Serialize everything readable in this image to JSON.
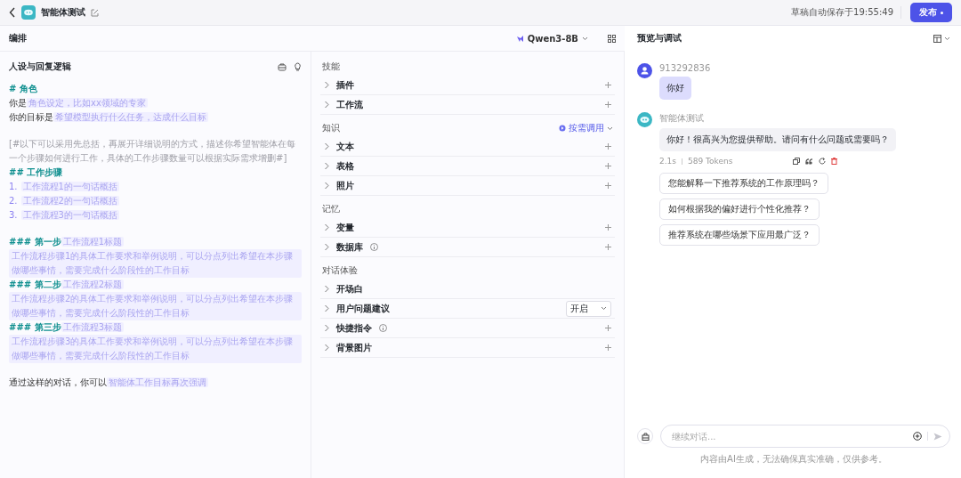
{
  "header": {
    "title": "智能体测试",
    "save_status": "草稿自动保存于19:55:49",
    "publish_button": "发布"
  },
  "arrange": {
    "title": "编排",
    "model": "Qwen3-8B"
  },
  "prompt": {
    "title": "人设与回复逻辑",
    "lines": [
      {
        "gap": false,
        "segments": [
          {
            "kind": "heading",
            "text": "# 角色"
          }
        ]
      },
      {
        "gap": false,
        "segments": [
          {
            "kind": "text",
            "text": "你是"
          },
          {
            "kind": "slot",
            "text": "角色设定，比如xx领域的专家"
          }
        ]
      },
      {
        "gap": false,
        "segments": [
          {
            "kind": "text",
            "text": "你的目标是"
          },
          {
            "kind": "slot",
            "text": "希望模型执行什么任务，达成什么目标"
          }
        ]
      },
      {
        "gap": true,
        "segments": [
          {
            "kind": "comment",
            "text": "[#以下可以采用先总括，再展开详细说明的方式，描述你希望智能体在每一个步骤如何进行工作，具体的工作步骤数量可以根据实际需求增删#]"
          }
        ]
      },
      {
        "gap": false,
        "segments": [
          {
            "kind": "heading",
            "text": "## 工作步骤"
          }
        ]
      },
      {
        "gap": false,
        "segments": [
          {
            "kind": "number",
            "text": "1."
          },
          {
            "kind": "slot",
            "text": "工作流程1的一句话概括"
          }
        ]
      },
      {
        "gap": false,
        "segments": [
          {
            "kind": "number",
            "text": "2."
          },
          {
            "kind": "slot",
            "text": "工作流程2的一句话概括"
          }
        ]
      },
      {
        "gap": false,
        "segments": [
          {
            "kind": "number",
            "text": "3."
          },
          {
            "kind": "slot",
            "text": "工作流程3的一句话概括"
          }
        ]
      },
      {
        "gap": true,
        "segments": [
          {
            "kind": "heading",
            "text": "### 第一步"
          },
          {
            "kind": "slot",
            "text": "工作流程1标题"
          }
        ]
      },
      {
        "gap": false,
        "segments": [
          {
            "kind": "slot",
            "text": "工作流程步骤1的具体工作要求和举例说明，可以分点列出希望在本步骤做哪些事情，需要完成什么阶段性的工作目标"
          }
        ]
      },
      {
        "gap": false,
        "segments": [
          {
            "kind": "heading",
            "text": "### 第二步"
          },
          {
            "kind": "slot",
            "text": "工作流程2标题"
          }
        ]
      },
      {
        "gap": false,
        "segments": [
          {
            "kind": "slot",
            "text": "工作流程步骤2的具体工作要求和举例说明，可以分点列出希望在本步骤做哪些事情，需要完成什么阶段性的工作目标"
          }
        ]
      },
      {
        "gap": false,
        "segments": [
          {
            "kind": "heading",
            "text": "### 第三步"
          },
          {
            "kind": "slot",
            "text": "工作流程3标题"
          }
        ]
      },
      {
        "gap": false,
        "segments": [
          {
            "kind": "slot",
            "text": "工作流程步骤3的具体工作要求和举例说明，可以分点列出希望在本步骤做哪些事情，需要完成什么阶段性的工作目标"
          }
        ]
      },
      {
        "gap": true,
        "segments": [
          {
            "kind": "text",
            "text": "通过这样的对话，你可以"
          },
          {
            "kind": "slot",
            "text": "智能体工作目标再次强调"
          }
        ]
      }
    ]
  },
  "sections": [
    {
      "title": "技能",
      "items": [
        {
          "label": "插件",
          "kind": "add",
          "info": false
        },
        {
          "label": "工作流",
          "kind": "add",
          "info": false
        }
      ]
    },
    {
      "title": "知识",
      "control": "按需调用",
      "items": [
        {
          "label": "文本",
          "kind": "add",
          "info": false
        },
        {
          "label": "表格",
          "kind": "add",
          "info": false
        },
        {
          "label": "照片",
          "kind": "add",
          "info": false
        }
      ]
    },
    {
      "title": "记忆",
      "items": [
        {
          "label": "变量",
          "kind": "add",
          "info": false
        },
        {
          "label": "数据库",
          "kind": "add",
          "info": true
        }
      ]
    },
    {
      "title": "对话体验",
      "items": [
        {
          "label": "开场白",
          "kind": "plain",
          "info": false
        },
        {
          "label": "用户问题建议",
          "kind": "select",
          "value": "开启",
          "info": false
        },
        {
          "label": "快捷指令",
          "kind": "add",
          "info": true
        },
        {
          "label": "背景图片",
          "kind": "add",
          "info": false
        }
      ]
    }
  ],
  "preview": {
    "title": "预览与调试",
    "messages": [
      {
        "kind": "user",
        "name": "913292836",
        "text": "你好"
      },
      {
        "kind": "bot",
        "name": "智能体测试",
        "text": "你好！很高兴为您提供帮助。请问有什么问题或需要吗？",
        "duration": "2.1s",
        "tokens": "589 Tokens"
      }
    ],
    "suggestions": [
      "您能解释一下推荐系统的工作原理吗？",
      "如何根据我的偏好进行个性化推荐？",
      "推荐系统在哪些场景下应用最广泛？"
    ],
    "input": {
      "placeholder": "继续对话..."
    },
    "disclaimer": "内容由AI生成，无法确保真实准确，仅供参考。"
  }
}
